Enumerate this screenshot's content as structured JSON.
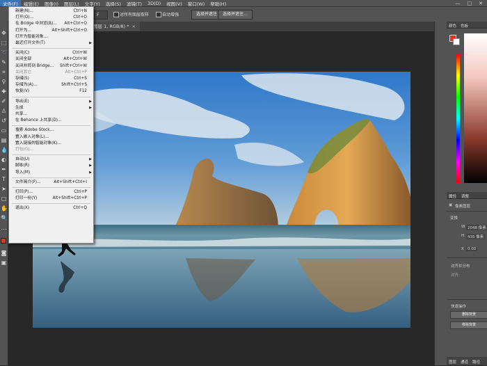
{
  "menubar": {
    "items": [
      "文件(F)",
      "编辑(E)",
      "图像(I)",
      "图层(L)",
      "文字(Y)",
      "选择(S)",
      "滤镜(T)",
      "3D(D)",
      "视图(V)",
      "窗口(W)",
      "帮助(H)"
    ],
    "controls": [
      "—",
      "□",
      "✕"
    ]
  },
  "options_bar": {
    "field1": "F",
    "check1_label": "对所有图层取样",
    "check2_label": "自动增强",
    "button1": "选择并遮住...",
    "button2": "选择并遮住..."
  },
  "document_tab": {
    "title": "图层 1, RGB/8) *",
    "close": "×"
  },
  "file_menu": {
    "items": [
      {
        "label": "新建(N)...",
        "shortcut": "Ctrl+N"
      },
      {
        "label": "打开(O)...",
        "shortcut": "Ctrl+O"
      },
      {
        "label": "在 Bridge 中浏览(B)...",
        "shortcut": "Alt+Ctrl+O"
      },
      {
        "label": "打开为...",
        "shortcut": "Alt+Shift+Ctrl+O"
      },
      {
        "label": "打开为智能对象...",
        "shortcut": ""
      },
      {
        "label": "最近打开文件(T)",
        "shortcut": "",
        "submenu": true
      },
      {
        "sep": true
      },
      {
        "label": "关闭(C)",
        "shortcut": "Ctrl+W"
      },
      {
        "label": "关闭全部",
        "shortcut": "Alt+Ctrl+W"
      },
      {
        "label": "关闭并转到 Bridge...",
        "shortcut": "Shift+Ctrl+W"
      },
      {
        "label": "关闭其它",
        "shortcut": "Alt+Ctrl+P",
        "disabled": true
      },
      {
        "label": "存储(S)",
        "shortcut": "Ctrl+S"
      },
      {
        "label": "存储为(A)...",
        "shortcut": "Shift+Ctrl+S"
      },
      {
        "label": "恢复(V)",
        "shortcut": "F12"
      },
      {
        "sep": true
      },
      {
        "label": "导出(E)",
        "shortcut": "",
        "submenu": true
      },
      {
        "label": "生成",
        "shortcut": "",
        "submenu": true
      },
      {
        "label": "共享...",
        "shortcut": ""
      },
      {
        "label": "在 Behance 上共享(D)...",
        "shortcut": ""
      },
      {
        "sep": true
      },
      {
        "label": "搜索 Adobe Stock...",
        "shortcut": ""
      },
      {
        "label": "置入嵌入对象(L)...",
        "shortcut": ""
      },
      {
        "label": "置入链接的智能对象(K)...",
        "shortcut": ""
      },
      {
        "label": "打包(G)...",
        "shortcut": "",
        "disabled": true
      },
      {
        "sep": true
      },
      {
        "label": "自动(U)",
        "shortcut": "",
        "submenu": true
      },
      {
        "label": "脚本(R)",
        "shortcut": "",
        "submenu": true
      },
      {
        "label": "导入(M)",
        "shortcut": "",
        "submenu": true
      },
      {
        "sep": true
      },
      {
        "label": "文件简介(F)...",
        "shortcut": "Alt+Shift+Ctrl+I"
      },
      {
        "sep": true
      },
      {
        "label": "打印(P)...",
        "shortcut": "Ctrl+P"
      },
      {
        "label": "打印一份(Y)",
        "shortcut": "Alt+Shift+Ctrl+P"
      },
      {
        "sep": true
      },
      {
        "label": "退出(X)",
        "shortcut": "Ctrl+Q"
      }
    ]
  },
  "right_panel": {
    "top_tabs": [
      "颜色",
      "色板"
    ],
    "props_tabs": [
      "属性",
      "调整"
    ],
    "props_title": "像素图层",
    "transform_label": "变换",
    "w_label": "W",
    "w_value": "2048 像素",
    "h_label": "H",
    "h_value": "435 像素",
    "x_label": "X",
    "x_value": "0.00",
    "align_label": "对齐并分布",
    "align_sub": "对齐:",
    "quick_label": "快速操作",
    "quick_btn1": "删除背景",
    "quick_btn2": "移除背景",
    "bottom_tabs": [
      "图层",
      "通道",
      "路径"
    ]
  },
  "colors": {
    "foreground": "#d6391f",
    "background": "#ffffff",
    "menu_highlight": "#3a73b8"
  }
}
